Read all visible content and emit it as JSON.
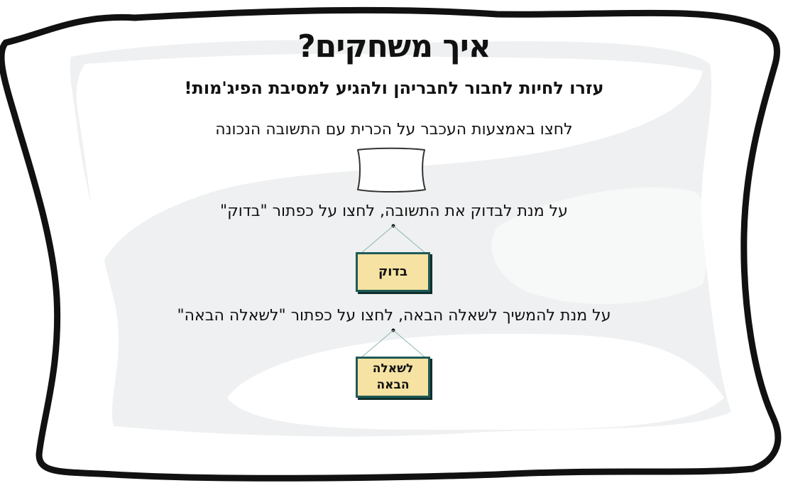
{
  "instructions": {
    "title": "איך משחקים?",
    "subtitle": "עזרו לחיות לחבור לחבריהן ולהגיע למסיבת הפיג'מות!",
    "step_pillow": "לחצו באמצעות העכבר על הכרית עם התשובה הנכונה",
    "step_check": "על מנת לבדוק את התשובה, לחצו על כפתור \"בדוק\"",
    "step_next": "על מנת להמשיך לשאלה הבאה, לחצו על כפתור \"לשאלה הבאה\""
  },
  "buttons": {
    "check_label": "בדוק",
    "next_label_line1": "לשאלה",
    "next_label_line2": "הבאה"
  },
  "colors": {
    "button_fill": "#f6e3a3",
    "button_border": "#1f5a57",
    "pillow_fill": "#f2f3f4",
    "outline": "#111111"
  }
}
